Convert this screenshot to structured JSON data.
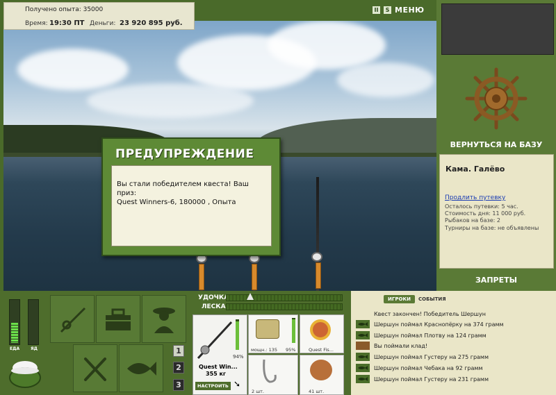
{
  "top_info": {
    "exp_received": "Получено опыта: 35000",
    "time_label": "Время:",
    "time_value": "19:30 ПТ",
    "money_label": "Деньги:",
    "money_value": "23 920 895 руб."
  },
  "top_bar": {
    "pause_icon": "II",
    "sound_icon": "S",
    "menu_label": "МЕНЮ"
  },
  "right_panel": {
    "back_to_base": "ВЕРНУТЬСЯ НА БАЗУ",
    "location": "Кама. Галёво",
    "extend_link": "Продлить путевку",
    "lines": [
      "Осталось путевки: 5 час.",
      "Стоимость дня: 11 000 руб.",
      "Рыбаков на базе: 2",
      "Турниры на базе: не объявлены"
    ],
    "bans": "ЗАПРЕТЫ"
  },
  "dialog": {
    "title": "ПРЕДУПРЕЖДЕНИЕ",
    "line1": "Вы стали победителем квеста! Ваш приз:",
    "line2": "Quest Winners-6, 180000 , Опыта"
  },
  "gauges": {
    "food_label": "ЕДА",
    "poison_label": "ЯД",
    "food_level": 0.45,
    "poison_level": 0
  },
  "pages": [
    "1",
    "2",
    "3"
  ],
  "tackle": {
    "rod_label": "УДОЧКА",
    "line_label": "ЛЕСКА",
    "rod_name": "Quest Win...",
    "rod_weight": "355 кг",
    "rod_percent": "94%",
    "adjust_button": "НАСТРОИТЬ",
    "reel_power": "мощн.: 135",
    "reel_percent": "95%",
    "line_name": "Quest Fis...",
    "hook_count": "2 шт.",
    "bait_count": "41 шт."
  },
  "events": {
    "tab_players": "ИГРОКИ",
    "tab_events": "СОБЫТИЯ",
    "items": [
      {
        "icon": "",
        "text": "Квест закончен! Победитель Шершун"
      },
      {
        "icon": "fish-icon",
        "text": "Шершун поймал Краснопёрку на 374 грамм"
      },
      {
        "icon": "fish-icon",
        "text": "Шершун поймал Плотву на 124 грамм"
      },
      {
        "icon": "chest-icon",
        "text": "Вы поймали клад!"
      },
      {
        "icon": "fish-icon",
        "text": "Шершун поймал Густеру на 275 грамм"
      },
      {
        "icon": "fish-icon",
        "text": "Шершун поймал Чебака на 92 грамм"
      },
      {
        "icon": "fish-icon",
        "text": "Шершун поймал Густеру на 231 грамм"
      }
    ]
  },
  "colors": {
    "panel_green": "#5a7a36",
    "panel_dark": "#4e6d2c",
    "parchment": "#eae6c8",
    "link": "#1a3cb3"
  }
}
